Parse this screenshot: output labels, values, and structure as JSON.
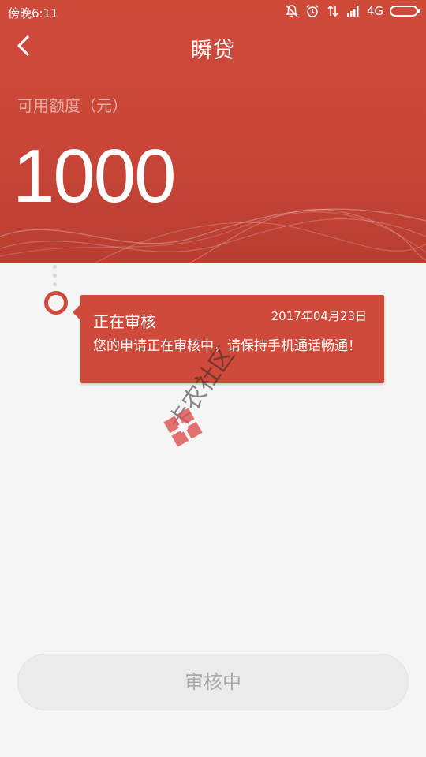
{
  "status_bar": {
    "time": "傍晚6:11",
    "network": "4G",
    "icons": [
      "silent-icon",
      "alarm-icon",
      "data-icon",
      "signal-icon",
      "battery-icon"
    ]
  },
  "header": {
    "title": "瞬贷",
    "limit_label": "可用额度（元）",
    "limit_amount": "1000",
    "back_icon": "chevron-left-icon"
  },
  "timeline": {
    "items": [
      {
        "title": "正在审核",
        "date": "2017年04月23日",
        "message": "您的申请正在审核中，请保持手机通话畅通！"
      }
    ]
  },
  "watermark": {
    "text": "卡农社区"
  },
  "footer": {
    "button_label": "审核中"
  },
  "colors": {
    "primary": "#cf4a3b",
    "background": "#f5f5f5",
    "button_bg": "#ebebeb",
    "button_text": "#a8a8a8"
  }
}
